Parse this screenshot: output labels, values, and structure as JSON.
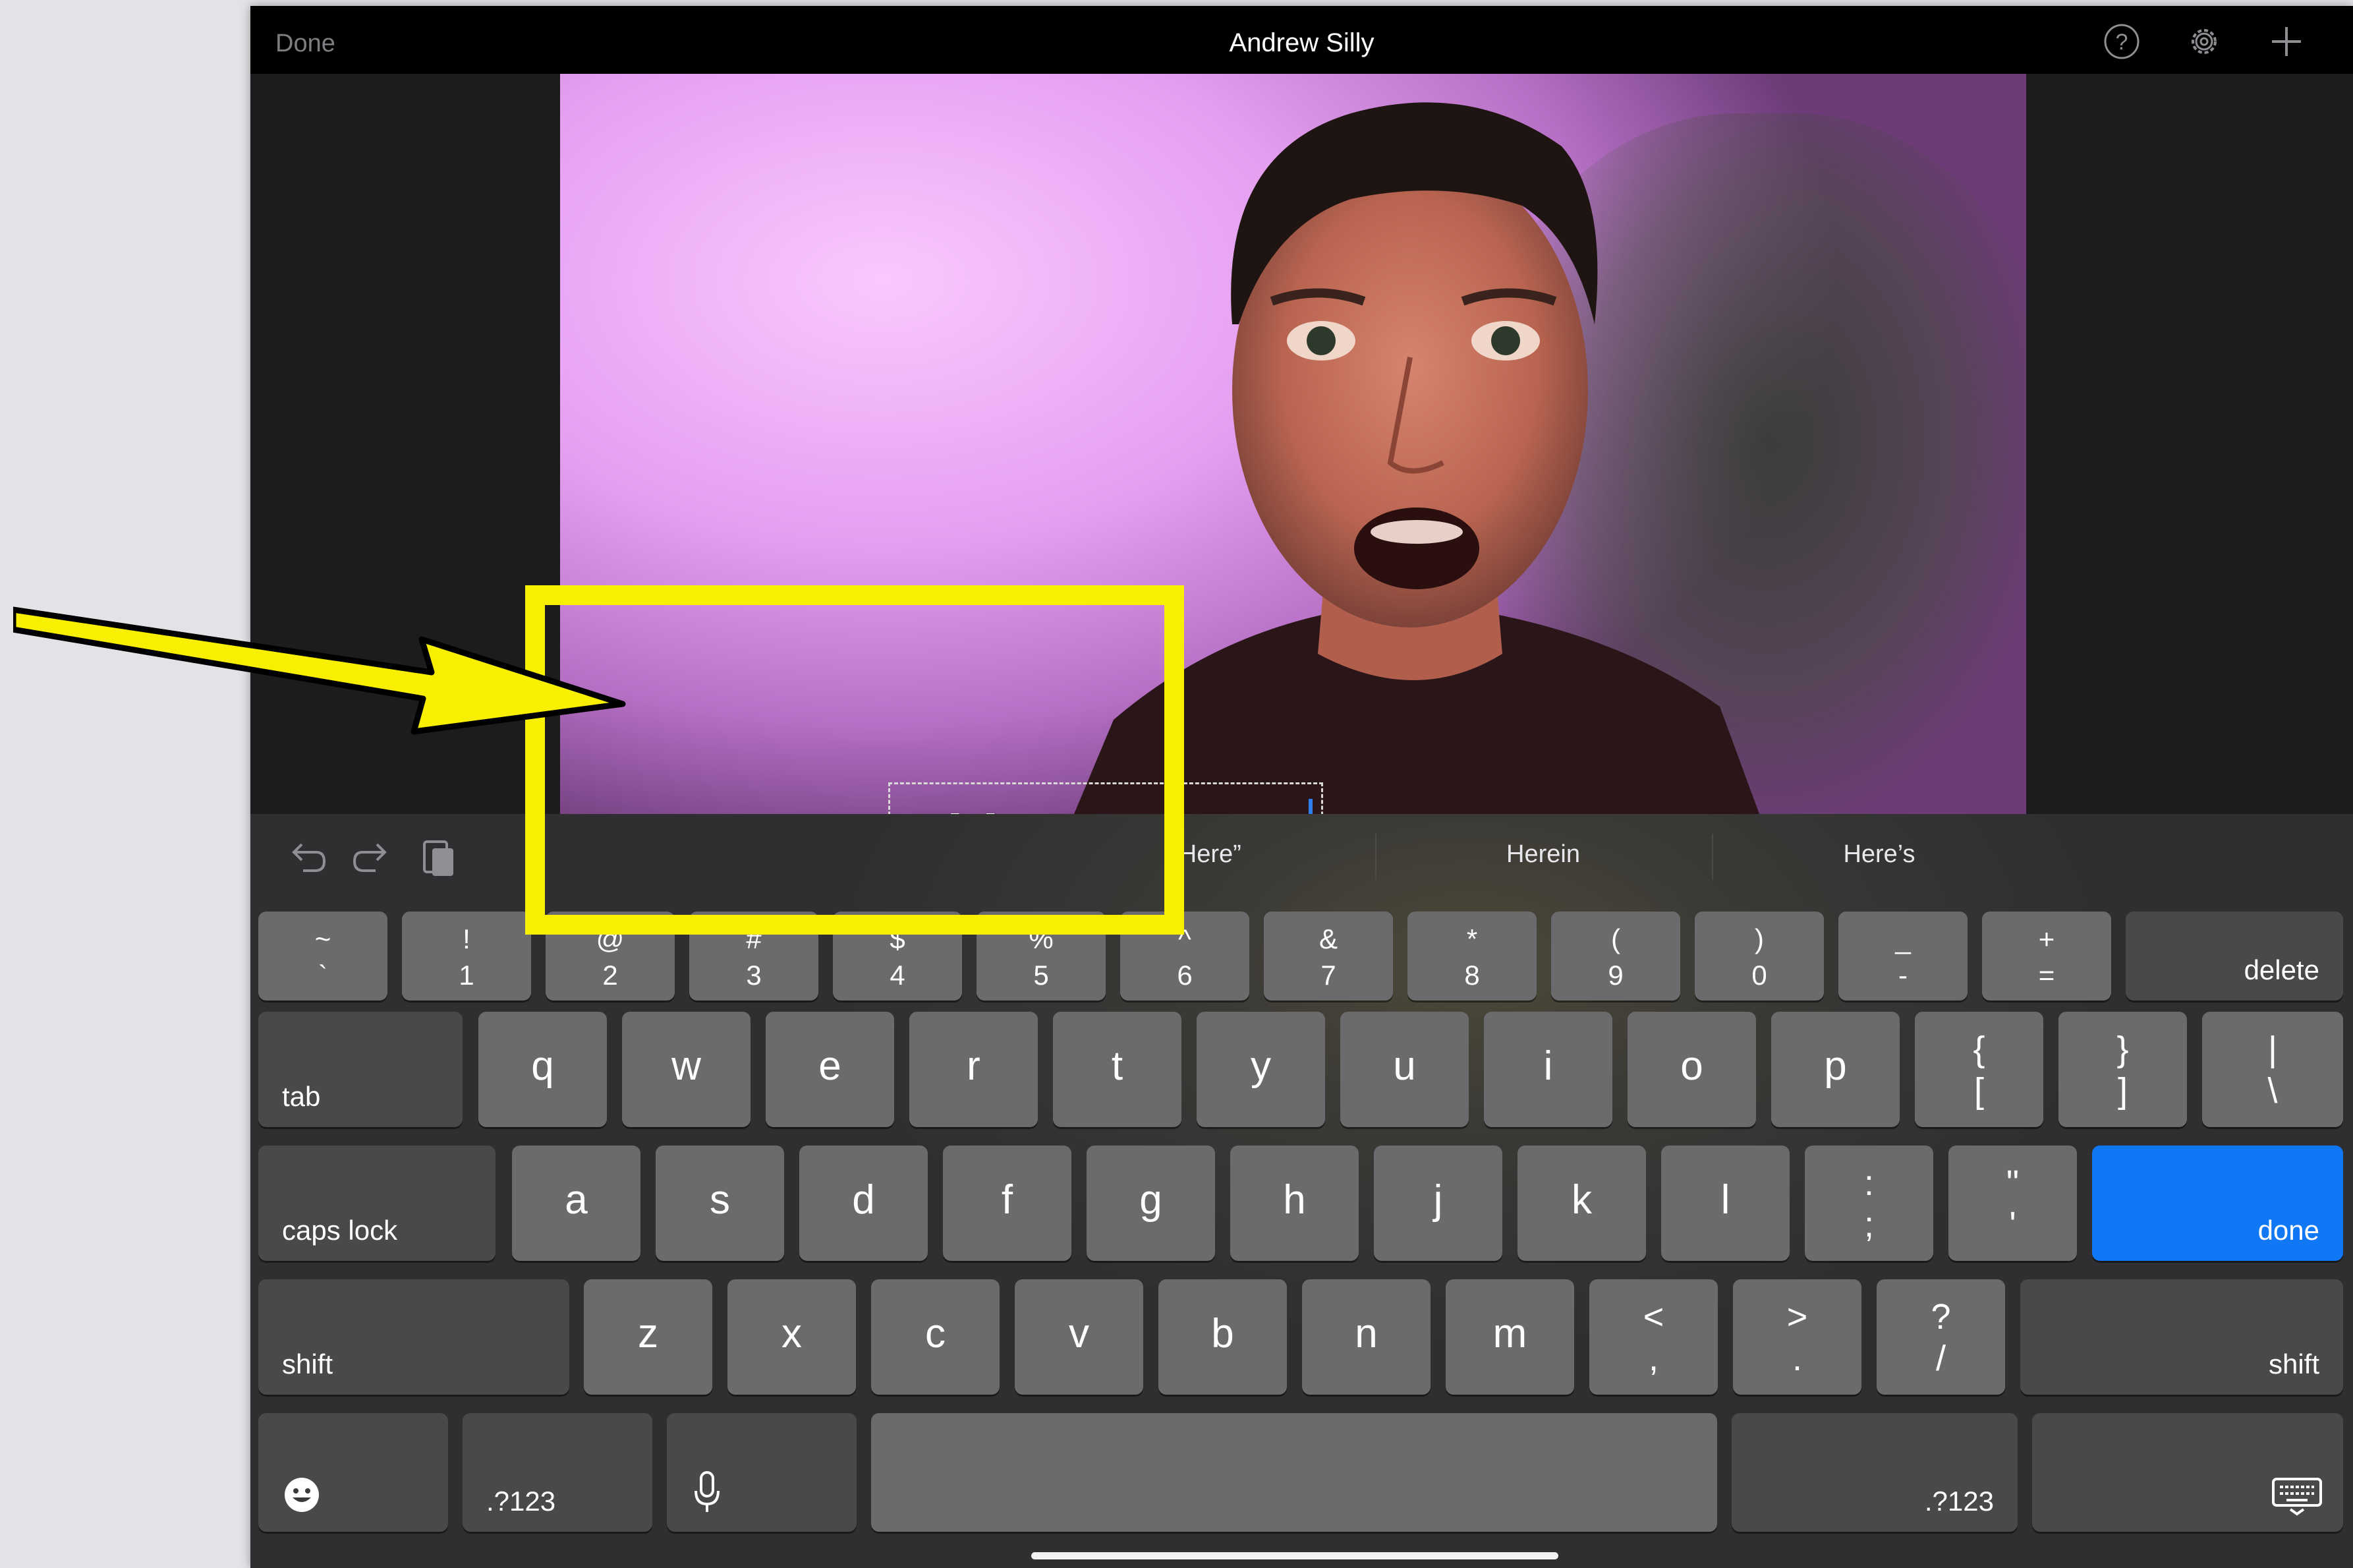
{
  "topbar": {
    "done_label": "Done",
    "title": "Andrew Silly",
    "icons": [
      "help-icon",
      "settings-gear-icon",
      "add-icon"
    ]
  },
  "title_overlay": {
    "text": "Title Text Here"
  },
  "keyboard": {
    "suggestions": [
      "“Here”",
      "Herein",
      "Here’s"
    ],
    "row1": [
      {
        "up": "~",
        "lo": "`"
      },
      {
        "up": "!",
        "lo": "1"
      },
      {
        "up": "@",
        "lo": "2"
      },
      {
        "up": "#",
        "lo": "3"
      },
      {
        "up": "$",
        "lo": "4"
      },
      {
        "up": "%",
        "lo": "5"
      },
      {
        "up": "^",
        "lo": "6"
      },
      {
        "up": "&",
        "lo": "7"
      },
      {
        "up": "*",
        "lo": "8"
      },
      {
        "up": "(",
        "lo": "9"
      },
      {
        "up": ")",
        "lo": "0"
      },
      {
        "up": "_",
        "lo": "-"
      },
      {
        "up": "+",
        "lo": "="
      }
    ],
    "delete_label": "delete",
    "tab_label": "tab",
    "row2_letters": [
      "q",
      "w",
      "e",
      "r",
      "t",
      "y",
      "u",
      "i",
      "o",
      "p"
    ],
    "row2_symbols": [
      {
        "up": "{",
        "lo": "["
      },
      {
        "up": "}",
        "lo": "]"
      },
      {
        "up": "|",
        "lo": "\\"
      }
    ],
    "caps_label": "caps lock",
    "row3_letters": [
      "a",
      "s",
      "d",
      "f",
      "g",
      "h",
      "j",
      "k",
      "l"
    ],
    "row3_symbols": [
      {
        "up": ":",
        "lo": ";"
      },
      {
        "up": "\"",
        "lo": "'"
      }
    ],
    "done_label": "done",
    "shift_label": "shift",
    "row4_letters": [
      "z",
      "x",
      "c",
      "v",
      "b",
      "n",
      "m"
    ],
    "row4_symbols": [
      {
        "up": "<",
        "lo": ","
      },
      {
        "up": ">",
        "lo": "."
      },
      {
        "up": "?",
        "lo": "/"
      }
    ],
    "numbers_label": ".?123",
    "icons": [
      "undo-icon",
      "redo-icon",
      "paste-icon",
      "emoji-icon",
      "microphone-icon",
      "dismiss-keyboard-icon"
    ]
  },
  "colors": {
    "highlight": "#f8f000",
    "done_key": "#1178f5",
    "cursor": "#2f7ff0"
  }
}
